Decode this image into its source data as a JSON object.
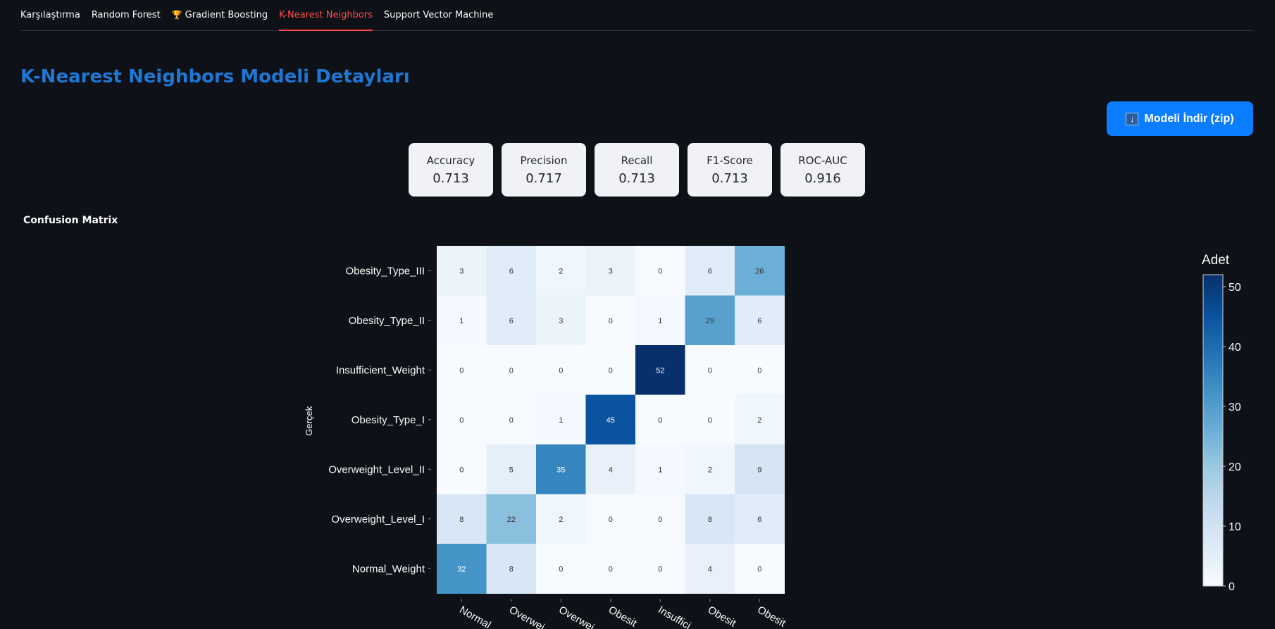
{
  "tabs": [
    {
      "label": "Karşılaştırma",
      "active": false,
      "icon": ""
    },
    {
      "label": "Random Forest",
      "active": false,
      "icon": ""
    },
    {
      "label": "Gradient Boosting",
      "active": false,
      "icon": "trophy-icon"
    },
    {
      "label": "K-Nearest Neighbors",
      "active": true,
      "icon": ""
    },
    {
      "label": "Support Vector Machine",
      "active": false,
      "icon": ""
    }
  ],
  "title": "K-Nearest Neighbors Modeli Detayları",
  "download_button": {
    "label": "Modeli İndir (zip)",
    "icon": "download-icon",
    "color": "#0b7dff"
  },
  "metrics": [
    {
      "label": "Accuracy",
      "value": "0.713"
    },
    {
      "label": "Precision",
      "value": "0.717"
    },
    {
      "label": "Recall",
      "value": "0.713"
    },
    {
      "label": "F1-Score",
      "value": "0.713"
    },
    {
      "label": "ROC-AUC",
      "value": "0.916"
    }
  ],
  "confusion_heading": "Confusion Matrix",
  "chart_data": {
    "type": "heatmap",
    "title": "",
    "ylabel": "Gerçek",
    "xlabel": "",
    "rows": [
      "Obesity_Type_III",
      "Obesity_Type_II",
      "Insufficient_Weight",
      "Obesity_Type_I",
      "Overweight_Level_II",
      "Overweight_Level_I",
      "Normal_Weight"
    ],
    "columns": [
      "Normal_Weight",
      "Overweight_Level_I",
      "Overweight_Level_II",
      "Obesity_Type_I",
      "Insufficient_Weight",
      "Obesity_Type_II",
      "Obesity_Type_III"
    ],
    "column_tick_labels_visible": [
      "Normal",
      "Overwei",
      "Overwei",
      "Obesit",
      "Insuffici",
      "Obesit",
      "Obesit"
    ],
    "values": [
      [
        3,
        6,
        2,
        3,
        0,
        6,
        26
      ],
      [
        1,
        6,
        3,
        0,
        1,
        29,
        6
      ],
      [
        0,
        0,
        0,
        0,
        52,
        0,
        0
      ],
      [
        0,
        0,
        1,
        45,
        0,
        0,
        2
      ],
      [
        0,
        5,
        35,
        4,
        1,
        2,
        9
      ],
      [
        8,
        22,
        2,
        0,
        0,
        8,
        6
      ],
      [
        32,
        8,
        0,
        0,
        0,
        4,
        0
      ]
    ],
    "colorscale": "Blues",
    "zlim": [
      0,
      52
    ],
    "colorbar": {
      "title": "Adet",
      "ticks": [
        0,
        10,
        20,
        30,
        40,
        50
      ]
    }
  }
}
